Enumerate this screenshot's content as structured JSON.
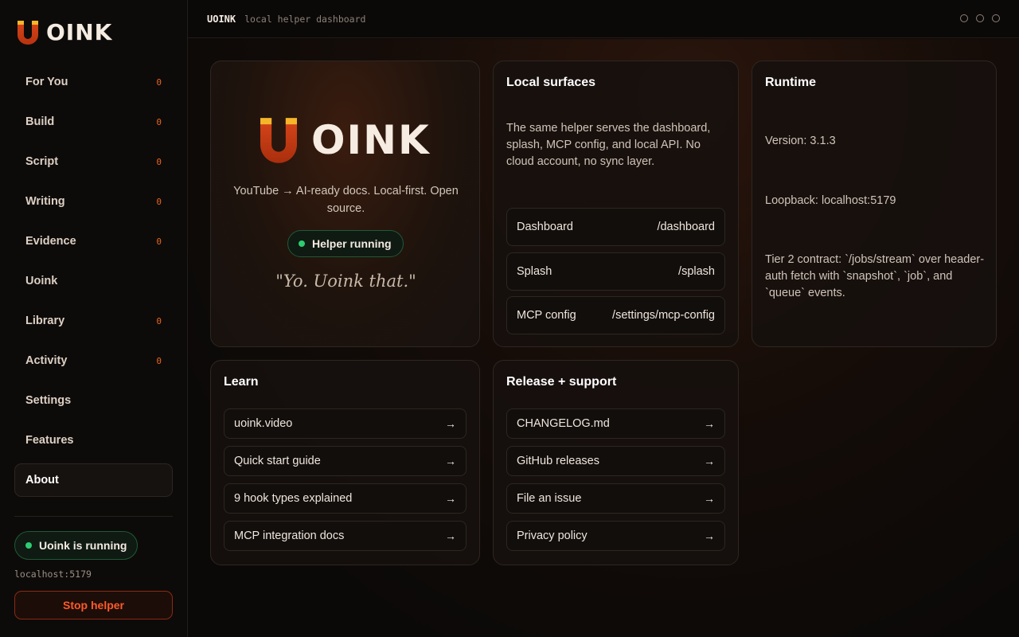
{
  "sidebar": {
    "logo_text": "OINK",
    "nav": [
      {
        "label": "For You",
        "count": "0"
      },
      {
        "label": "Build",
        "count": "0"
      },
      {
        "label": "Script",
        "count": "0"
      },
      {
        "label": "Writing",
        "count": "0"
      },
      {
        "label": "Evidence",
        "count": "0"
      },
      {
        "label": "Uoink",
        "count": ""
      },
      {
        "label": "Library",
        "count": "0"
      },
      {
        "label": "Activity",
        "count": "0"
      },
      {
        "label": "Settings",
        "count": ""
      },
      {
        "label": "Features",
        "count": ""
      },
      {
        "label": "About",
        "count": ""
      }
    ],
    "active_item": "About",
    "status_label": "Uoink is running",
    "host": "localhost:5179",
    "stop_button": "Stop helper"
  },
  "topbar": {
    "brand": "UOINK",
    "subtitle": "local helper dashboard"
  },
  "hero": {
    "logo_text": "OINK",
    "tagline": "YouTube → AI-ready docs. Local-first. Open source.",
    "status": "Helper running",
    "quote": "\"Yo. Uoink that.\""
  },
  "surfaces": {
    "title": "Local surfaces",
    "description": "The same helper serves the dashboard, splash, MCP config, and local API. No cloud account, no sync layer.",
    "routes": [
      {
        "name": "Dashboard",
        "path": "/dashboard"
      },
      {
        "name": "Splash",
        "path": "/splash"
      },
      {
        "name": "MCP config",
        "path": "/settings/mcp-config"
      }
    ]
  },
  "runtime": {
    "title": "Runtime",
    "version": "Version: 3.1.3",
    "loopback": "Loopback: localhost:5179",
    "contract": "Tier 2 contract: `/jobs/stream` over header-auth fetch with `snapshot`, `job`, and `queue` events."
  },
  "learn": {
    "title": "Learn",
    "links": [
      "uoink.video",
      "Quick start guide",
      "9 hook types explained",
      "MCP integration docs"
    ]
  },
  "release": {
    "title": "Release + support",
    "links": [
      "CHANGELOG.md",
      "GitHub releases",
      "File an issue",
      "Privacy policy"
    ]
  },
  "icons": {
    "arrow": "arrow-right-icon",
    "logo_mark": "uoink-u-logo"
  },
  "colors": {
    "accent": "#e8641f",
    "logo_top": "#f5b62a",
    "logo_bottom": "#d8461a",
    "status_green": "#2ecc71",
    "danger": "#ff5a2a"
  }
}
